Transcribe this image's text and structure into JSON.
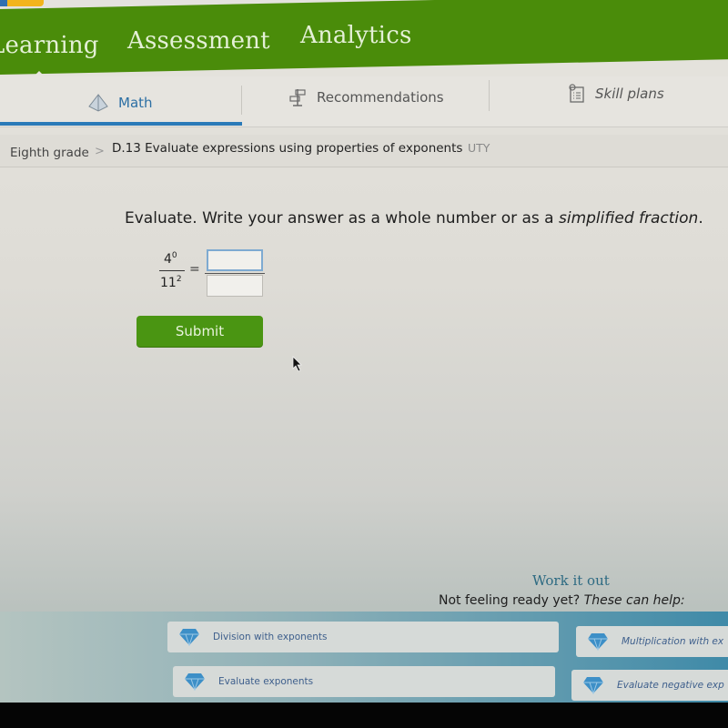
{
  "top_nav": {
    "items": [
      {
        "label": "Learning",
        "active": true
      },
      {
        "label": "Assessment",
        "active": false
      },
      {
        "label": "Analytics",
        "active": false
      }
    ]
  },
  "sub_nav": {
    "tabs": [
      {
        "label": "Math",
        "icon": "pyramid-icon",
        "active": true
      },
      {
        "label": "Recommendations",
        "icon": "signpost-icon",
        "active": false
      },
      {
        "label": "Skill plans",
        "icon": "clipboard-checklist-icon",
        "active": false
      }
    ]
  },
  "breadcrumb": {
    "grade": "Eighth grade",
    "separator": ">",
    "skill": "D.13 Evaluate expressions using properties of exponents",
    "code": "UTY"
  },
  "problem": {
    "instruction_prefix": "Evaluate. Write your answer as a whole number or as a ",
    "instruction_italic": "simplified fraction",
    "instruction_suffix": ".",
    "numerator_base": "4",
    "numerator_exp": "0",
    "denominator_base": "11",
    "denominator_exp": "2",
    "equals": "=",
    "answer_numerator": "",
    "answer_denominator": ""
  },
  "submit_button": {
    "label": "Submit"
  },
  "help": {
    "title": "Work it out",
    "subtitle_prefix": "Not feeling ready yet? ",
    "subtitle_italic": "These can help:",
    "items": [
      {
        "label": "Division with exponents",
        "icon": "diamond-icon"
      },
      {
        "label": "Multiplication with ex",
        "icon": "diamond-icon"
      },
      {
        "label": "Evaluate exponents",
        "icon": "diamond-icon"
      },
      {
        "label": "Evaluate negative exp",
        "icon": "diamond-icon"
      }
    ]
  },
  "colors": {
    "brand_green": "#4a8c0a",
    "submit_green": "#4a9512",
    "tab_active_blue": "#2a7ab8",
    "help_title_teal": "#2d6a82",
    "diamond_blue": "#3d8fc7"
  }
}
